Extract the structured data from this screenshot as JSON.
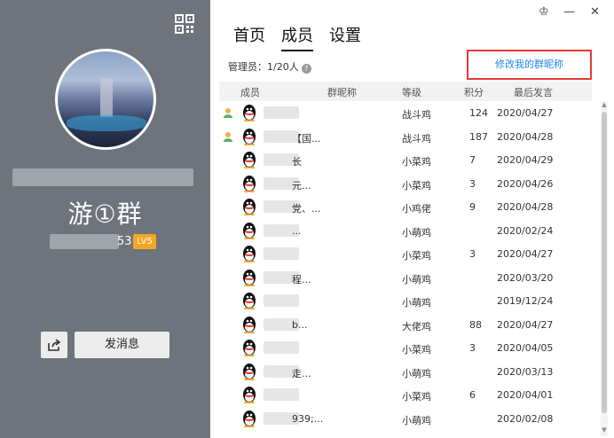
{
  "left": {
    "group_name": "游①群",
    "group_id_tail": "53",
    "level_badge": "LV5",
    "send_message_label": "发消息",
    "qr_icon": "qr-code-icon",
    "share_icon": "share-icon"
  },
  "window": {
    "skin_icon": "♔",
    "minimize_icon": "—",
    "close_icon": "✕"
  },
  "tabs": [
    {
      "label": "首页"
    },
    {
      "label": "成员"
    },
    {
      "label": "设置"
    }
  ],
  "active_tab": "成员",
  "admins_label": "管理员：1/20人",
  "edit_nickname_label": "修改我的群昵称",
  "table": {
    "headers": [
      "成员",
      "群昵称",
      "等级",
      "积分",
      "最后发言"
    ],
    "rows": [
      {
        "crown": true,
        "nickname": "",
        "level": "战斗鸡",
        "points": "124",
        "last": "2020/04/27"
      },
      {
        "crown": true,
        "nickname": "【国...",
        "level": "战斗鸡",
        "points": "187",
        "last": "2020/04/28"
      },
      {
        "crown": false,
        "nickname": "长",
        "level": "小菜鸡",
        "points": "7",
        "last": "2020/04/29"
      },
      {
        "crown": false,
        "nickname": "元...",
        "level": "小菜鸡",
        "points": "3",
        "last": "2020/04/26"
      },
      {
        "crown": false,
        "nickname": "党、...",
        "level": "小鸡佬",
        "points": "9",
        "last": "2020/04/28"
      },
      {
        "crown": false,
        "nickname": "...",
        "level": "小萌鸡",
        "points": "",
        "last": "2020/02/24"
      },
      {
        "crown": false,
        "nickname": "",
        "level": "小菜鸡",
        "points": "3",
        "last": "2020/04/27"
      },
      {
        "crown": false,
        "nickname": "程...",
        "level": "小萌鸡",
        "points": "",
        "last": "2020/03/20"
      },
      {
        "crown": false,
        "nickname": "",
        "level": "小萌鸡",
        "points": "",
        "last": "2019/12/24"
      },
      {
        "crown": false,
        "nickname": "b...",
        "level": "大佬鸡",
        "points": "88",
        "last": "2020/04/27"
      },
      {
        "crown": false,
        "nickname": "",
        "level": "小菜鸡",
        "points": "3",
        "last": "2020/04/05"
      },
      {
        "crown": false,
        "nickname": "走...",
        "level": "小萌鸡",
        "points": "",
        "last": "2020/03/13"
      },
      {
        "crown": false,
        "nickname": "",
        "level": "小菜鸡",
        "points": "6",
        "last": "2020/04/01"
      },
      {
        "crown": false,
        "nickname": "939;...",
        "level": "小萌鸡",
        "points": "",
        "last": "2020/02/08"
      }
    ]
  },
  "colors": {
    "left_bg": "#6e737c",
    "accent_blue": "#1e88e5",
    "highlight_red": "#e53935",
    "level_orange": "#f5a623"
  }
}
